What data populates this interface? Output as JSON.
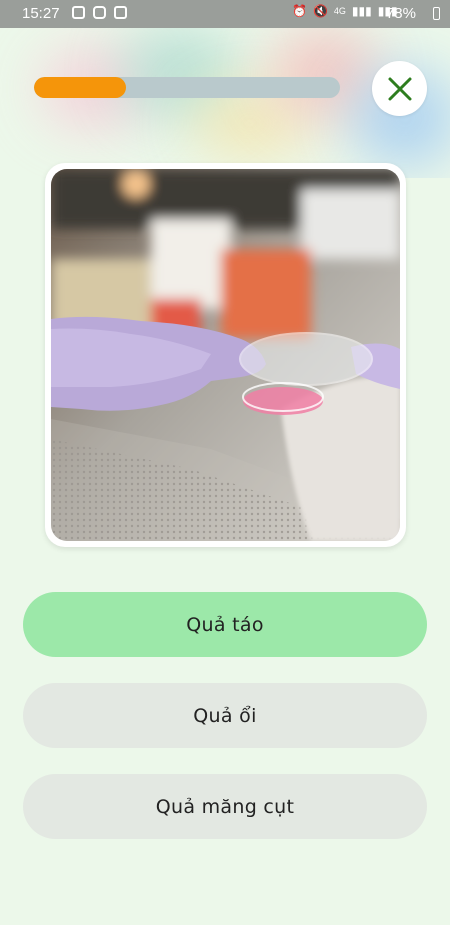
{
  "status_bar": {
    "time": "15:27",
    "network": "4G",
    "battery": "78%",
    "left_icons": [
      "gallery-icon",
      "instagram-icon",
      "screencast-icon"
    ],
    "right_icons": [
      "alarm-icon",
      "mute-icon",
      "signal-icon",
      "signal-icon",
      "battery-icon"
    ]
  },
  "quiz": {
    "progress_fraction": 0.3,
    "progress_color": "#f5950a",
    "track_color": "#b9c9cc",
    "close_icon": "close-icon",
    "close_color": "#2e7d1e"
  },
  "answers": [
    {
      "label": "Quả táo",
      "state": "selected"
    },
    {
      "label": "Quả ổi",
      "state": "normal"
    },
    {
      "label": "Quả măng cụt",
      "state": "normal"
    }
  ],
  "colors": {
    "background": "#ecf8ea",
    "selected": "#9ce8a9",
    "option": "#e3e8e2"
  }
}
